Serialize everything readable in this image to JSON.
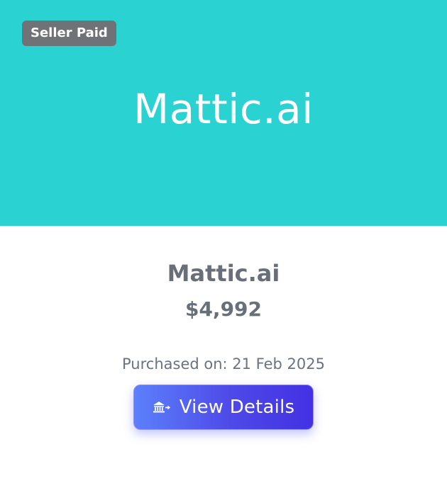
{
  "banner": {
    "badge_label": "Seller Paid",
    "title": "Mattic.ai",
    "background_color": "#2ad2d1"
  },
  "details": {
    "product_name": "Mattic.ai",
    "price": "$4,992",
    "purchased_text": "Purchased on: 21 Feb 2025"
  },
  "actions": {
    "view_details_label": "View Details",
    "view_details_icon": "bank-transfer-icon",
    "gradient_start": "#5c80fb",
    "gradient_end": "#4331e3"
  }
}
